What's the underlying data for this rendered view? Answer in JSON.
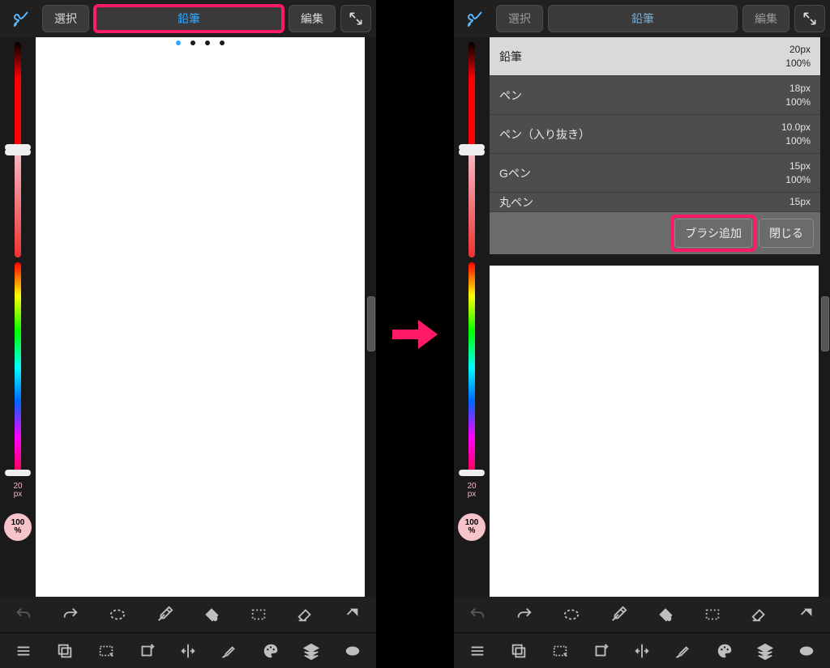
{
  "toolbar": {
    "select_label": "選択",
    "brush_title": "鉛筆",
    "edit_label": "編集"
  },
  "size_readout": {
    "value": "20",
    "unit": "px"
  },
  "opacity_readout": {
    "value": "100",
    "unit": "%"
  },
  "page_indicator": {
    "total": 4,
    "active_index": 0
  },
  "brush_list": {
    "items": [
      {
        "name": "鉛筆",
        "size": "20px",
        "opacity": "100%",
        "selected": true
      },
      {
        "name": "ペン",
        "size": "18px",
        "opacity": "100%",
        "selected": false
      },
      {
        "name": "ペン（入り抜き）",
        "size": "10.0px",
        "opacity": "100%",
        "selected": false
      },
      {
        "name": "Gペン",
        "size": "15px",
        "opacity": "100%",
        "selected": false
      },
      {
        "name": "丸ペン",
        "size": "15px",
        "opacity": "",
        "selected": false
      }
    ],
    "add_button_label": "ブラシ追加",
    "close_button_label": "閉じる"
  },
  "bottom_icons_row1": [
    "undo",
    "redo",
    "transform",
    "eyedropper",
    "bucket",
    "marquee",
    "eraser",
    "redo-alt"
  ],
  "bottom_icons_row2": [
    "menu",
    "copy",
    "crop-marquee",
    "rotate",
    "flip-h",
    "brush-settings",
    "palette",
    "layers",
    "ellipse"
  ],
  "colors": {
    "highlight": "#ff1a66",
    "brush_title": "#2ea7ff"
  }
}
